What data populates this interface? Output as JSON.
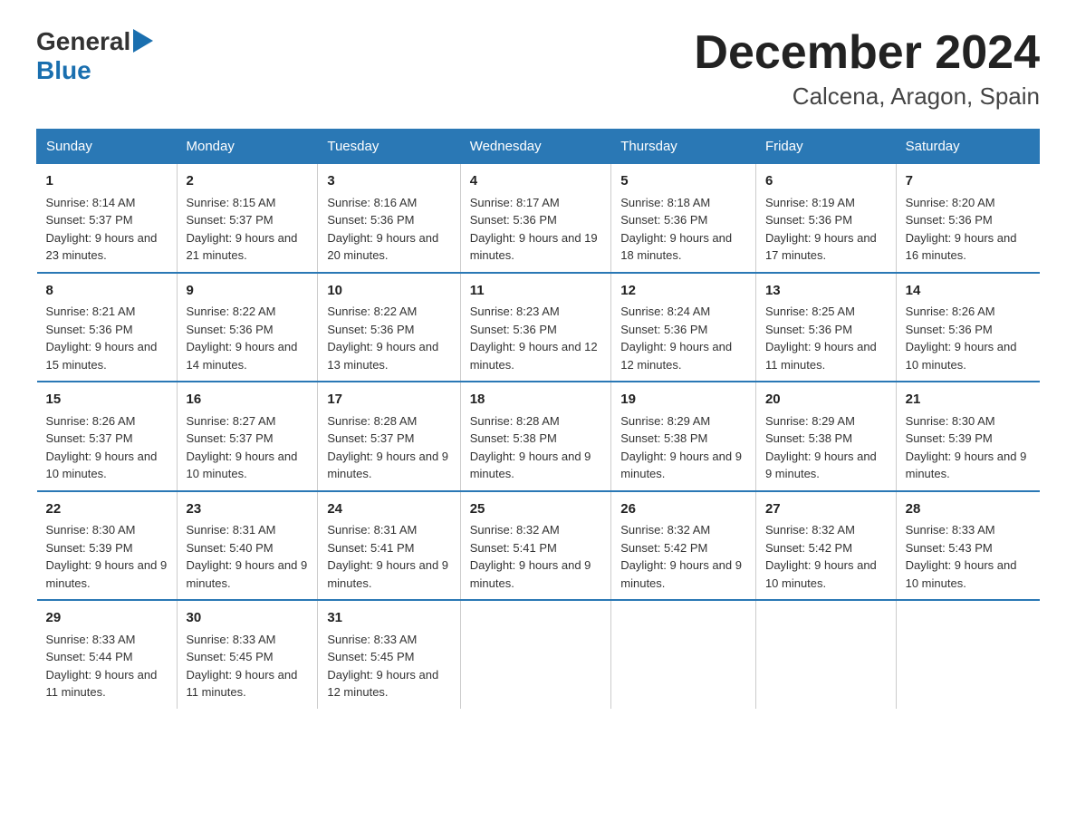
{
  "logo": {
    "text_general": "General",
    "text_blue": "Blue",
    "arrow_char": "▶"
  },
  "title": "December 2024",
  "subtitle": "Calcena, Aragon, Spain",
  "days_of_week": [
    "Sunday",
    "Monday",
    "Tuesday",
    "Wednesday",
    "Thursday",
    "Friday",
    "Saturday"
  ],
  "weeks": [
    [
      {
        "day": "1",
        "sunrise": "Sunrise: 8:14 AM",
        "sunset": "Sunset: 5:37 PM",
        "daylight": "Daylight: 9 hours and 23 minutes."
      },
      {
        "day": "2",
        "sunrise": "Sunrise: 8:15 AM",
        "sunset": "Sunset: 5:37 PM",
        "daylight": "Daylight: 9 hours and 21 minutes."
      },
      {
        "day": "3",
        "sunrise": "Sunrise: 8:16 AM",
        "sunset": "Sunset: 5:36 PM",
        "daylight": "Daylight: 9 hours and 20 minutes."
      },
      {
        "day": "4",
        "sunrise": "Sunrise: 8:17 AM",
        "sunset": "Sunset: 5:36 PM",
        "daylight": "Daylight: 9 hours and 19 minutes."
      },
      {
        "day": "5",
        "sunrise": "Sunrise: 8:18 AM",
        "sunset": "Sunset: 5:36 PM",
        "daylight": "Daylight: 9 hours and 18 minutes."
      },
      {
        "day": "6",
        "sunrise": "Sunrise: 8:19 AM",
        "sunset": "Sunset: 5:36 PM",
        "daylight": "Daylight: 9 hours and 17 minutes."
      },
      {
        "day": "7",
        "sunrise": "Sunrise: 8:20 AM",
        "sunset": "Sunset: 5:36 PM",
        "daylight": "Daylight: 9 hours and 16 minutes."
      }
    ],
    [
      {
        "day": "8",
        "sunrise": "Sunrise: 8:21 AM",
        "sunset": "Sunset: 5:36 PM",
        "daylight": "Daylight: 9 hours and 15 minutes."
      },
      {
        "day": "9",
        "sunrise": "Sunrise: 8:22 AM",
        "sunset": "Sunset: 5:36 PM",
        "daylight": "Daylight: 9 hours and 14 minutes."
      },
      {
        "day": "10",
        "sunrise": "Sunrise: 8:22 AM",
        "sunset": "Sunset: 5:36 PM",
        "daylight": "Daylight: 9 hours and 13 minutes."
      },
      {
        "day": "11",
        "sunrise": "Sunrise: 8:23 AM",
        "sunset": "Sunset: 5:36 PM",
        "daylight": "Daylight: 9 hours and 12 minutes."
      },
      {
        "day": "12",
        "sunrise": "Sunrise: 8:24 AM",
        "sunset": "Sunset: 5:36 PM",
        "daylight": "Daylight: 9 hours and 12 minutes."
      },
      {
        "day": "13",
        "sunrise": "Sunrise: 8:25 AM",
        "sunset": "Sunset: 5:36 PM",
        "daylight": "Daylight: 9 hours and 11 minutes."
      },
      {
        "day": "14",
        "sunrise": "Sunrise: 8:26 AM",
        "sunset": "Sunset: 5:36 PM",
        "daylight": "Daylight: 9 hours and 10 minutes."
      }
    ],
    [
      {
        "day": "15",
        "sunrise": "Sunrise: 8:26 AM",
        "sunset": "Sunset: 5:37 PM",
        "daylight": "Daylight: 9 hours and 10 minutes."
      },
      {
        "day": "16",
        "sunrise": "Sunrise: 8:27 AM",
        "sunset": "Sunset: 5:37 PM",
        "daylight": "Daylight: 9 hours and 10 minutes."
      },
      {
        "day": "17",
        "sunrise": "Sunrise: 8:28 AM",
        "sunset": "Sunset: 5:37 PM",
        "daylight": "Daylight: 9 hours and 9 minutes."
      },
      {
        "day": "18",
        "sunrise": "Sunrise: 8:28 AM",
        "sunset": "Sunset: 5:38 PM",
        "daylight": "Daylight: 9 hours and 9 minutes."
      },
      {
        "day": "19",
        "sunrise": "Sunrise: 8:29 AM",
        "sunset": "Sunset: 5:38 PM",
        "daylight": "Daylight: 9 hours and 9 minutes."
      },
      {
        "day": "20",
        "sunrise": "Sunrise: 8:29 AM",
        "sunset": "Sunset: 5:38 PM",
        "daylight": "Daylight: 9 hours and 9 minutes."
      },
      {
        "day": "21",
        "sunrise": "Sunrise: 8:30 AM",
        "sunset": "Sunset: 5:39 PM",
        "daylight": "Daylight: 9 hours and 9 minutes."
      }
    ],
    [
      {
        "day": "22",
        "sunrise": "Sunrise: 8:30 AM",
        "sunset": "Sunset: 5:39 PM",
        "daylight": "Daylight: 9 hours and 9 minutes."
      },
      {
        "day": "23",
        "sunrise": "Sunrise: 8:31 AM",
        "sunset": "Sunset: 5:40 PM",
        "daylight": "Daylight: 9 hours and 9 minutes."
      },
      {
        "day": "24",
        "sunrise": "Sunrise: 8:31 AM",
        "sunset": "Sunset: 5:41 PM",
        "daylight": "Daylight: 9 hours and 9 minutes."
      },
      {
        "day": "25",
        "sunrise": "Sunrise: 8:32 AM",
        "sunset": "Sunset: 5:41 PM",
        "daylight": "Daylight: 9 hours and 9 minutes."
      },
      {
        "day": "26",
        "sunrise": "Sunrise: 8:32 AM",
        "sunset": "Sunset: 5:42 PM",
        "daylight": "Daylight: 9 hours and 9 minutes."
      },
      {
        "day": "27",
        "sunrise": "Sunrise: 8:32 AM",
        "sunset": "Sunset: 5:42 PM",
        "daylight": "Daylight: 9 hours and 10 minutes."
      },
      {
        "day": "28",
        "sunrise": "Sunrise: 8:33 AM",
        "sunset": "Sunset: 5:43 PM",
        "daylight": "Daylight: 9 hours and 10 minutes."
      }
    ],
    [
      {
        "day": "29",
        "sunrise": "Sunrise: 8:33 AM",
        "sunset": "Sunset: 5:44 PM",
        "daylight": "Daylight: 9 hours and 11 minutes."
      },
      {
        "day": "30",
        "sunrise": "Sunrise: 8:33 AM",
        "sunset": "Sunset: 5:45 PM",
        "daylight": "Daylight: 9 hours and 11 minutes."
      },
      {
        "day": "31",
        "sunrise": "Sunrise: 8:33 AM",
        "sunset": "Sunset: 5:45 PM",
        "daylight": "Daylight: 9 hours and 12 minutes."
      },
      {
        "day": "",
        "sunrise": "",
        "sunset": "",
        "daylight": ""
      },
      {
        "day": "",
        "sunrise": "",
        "sunset": "",
        "daylight": ""
      },
      {
        "day": "",
        "sunrise": "",
        "sunset": "",
        "daylight": ""
      },
      {
        "day": "",
        "sunrise": "",
        "sunset": "",
        "daylight": ""
      }
    ]
  ]
}
